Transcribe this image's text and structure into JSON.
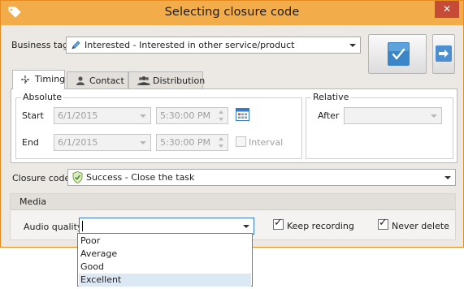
{
  "window": {
    "title": "Selecting closure code",
    "close_glyph": "✕"
  },
  "business_tag": {
    "label": "Business tag",
    "value": "Interested - Interested in other service/product",
    "icon": "pencil-icon"
  },
  "actions": {
    "confirm_icon": "checkmark-icon",
    "next_icon": "arrow-right-icon"
  },
  "tabs": [
    {
      "label": "Timing",
      "icon": "timer-icon",
      "active": true
    },
    {
      "label": "Contact",
      "icon": "person-icon",
      "active": false
    },
    {
      "label": "Distribution",
      "icon": "group-icon",
      "active": false
    }
  ],
  "timing": {
    "absolute": {
      "title": "Absolute",
      "start": {
        "label": "Start",
        "date": "6/1/2015",
        "time": "5:30:00 PM"
      },
      "end": {
        "label": "End",
        "date": "6/1/2015",
        "time": "5:30:00 PM"
      },
      "interval_label": "Interval"
    },
    "relative": {
      "title": "Relative",
      "after_label": "After",
      "after_value": ""
    }
  },
  "closure_code": {
    "label": "Closure code",
    "value": "Success - Close the task",
    "icon": "shield-check-icon"
  },
  "media": {
    "title": "Media",
    "audio_quality_label": "Audio quality",
    "audio_quality_value": "",
    "keep_recording_label": "Keep recording",
    "keep_recording_checked": true,
    "never_delete_label": "Never delete",
    "never_delete_checked": true,
    "options": [
      "Poor",
      "Average",
      "Good",
      "Excellent"
    ],
    "highlighted_option": "Excellent"
  },
  "colors": {
    "titlebar": "#f3ac4a",
    "close": "#c64b36",
    "accent_blue": "#3a86c8"
  }
}
